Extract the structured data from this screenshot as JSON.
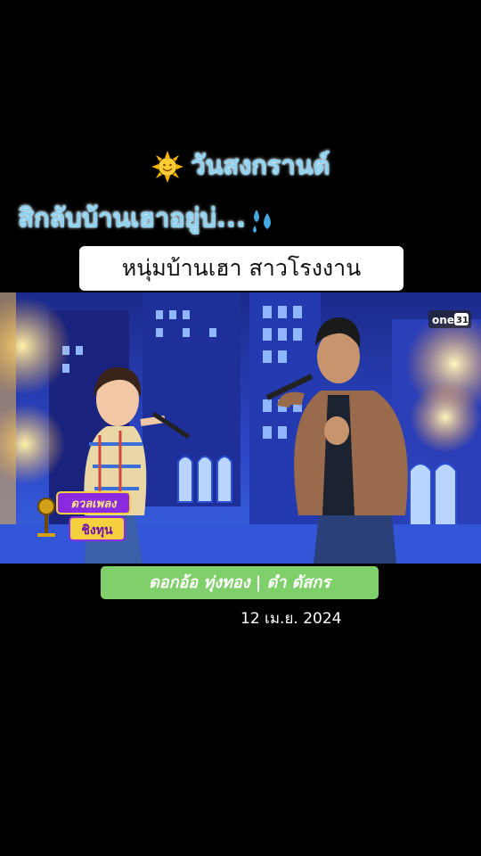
{
  "overlay": {
    "caption_line1": "วันสงกรานต์",
    "caption_line2": "สิกลับบ้านเฮาอยู่บ่...",
    "sun_icon": "sun-emoji-icon",
    "sweat_icon": "sweat-droplets-emoji-icon",
    "song_title": "หนุ่มบ้านเฮา สาวโรงงาน",
    "singers": "ดอกอ้อ ทุ่งทอง | ดำ ดัสกร",
    "date": "12 เม.ย. 2024"
  },
  "video": {
    "channel_logo_text": "one",
    "channel_number": "31",
    "show_logo_line1": "ดวลเพลง",
    "show_logo_line2": "ชิงทุน"
  },
  "colors": {
    "caption": "#8fd3f0",
    "song_title_bg": "#ffffff",
    "singers_bg": "#7fcf6a",
    "background": "#000000"
  }
}
